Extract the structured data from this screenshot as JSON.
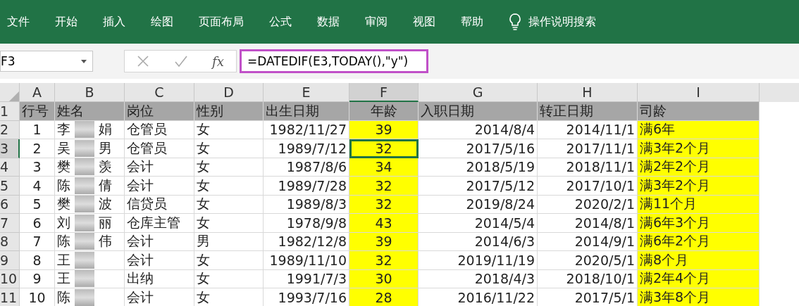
{
  "ribbon_tabs": [
    {
      "label": "文件"
    },
    {
      "label": "开始"
    },
    {
      "label": "插入"
    },
    {
      "label": "绘图"
    },
    {
      "label": "页面布局"
    },
    {
      "label": "公式"
    },
    {
      "label": "数据"
    },
    {
      "label": "审阅"
    },
    {
      "label": "视图"
    },
    {
      "label": "帮助"
    }
  ],
  "tell_me": {
    "label": "操作说明搜索"
  },
  "formula_bar": {
    "name_box": "F3",
    "fx": "fx",
    "formula": "=DATEDIF(E3,TODAY(),\"y\")"
  },
  "columns": [
    {
      "label": "A",
      "selected": false,
      "highlighted": false
    },
    {
      "label": "B",
      "selected": false,
      "highlighted": false
    },
    {
      "label": "C",
      "selected": false,
      "highlighted": false
    },
    {
      "label": "D",
      "selected": false,
      "highlighted": false
    },
    {
      "label": "E",
      "selected": false,
      "highlighted": false
    },
    {
      "label": "F",
      "selected": true,
      "highlighted": true
    },
    {
      "label": "G",
      "selected": false,
      "highlighted": false
    },
    {
      "label": "H",
      "selected": false,
      "highlighted": false
    },
    {
      "label": "I",
      "selected": false,
      "highlighted": true
    }
  ],
  "rows": [
    {
      "number": "1",
      "selected": false,
      "kind": "header",
      "cells": [
        "行号",
        "姓名",
        "岗位",
        "性别",
        "出生日期",
        "年龄",
        "入职日期",
        "转正日期",
        "司龄"
      ]
    },
    {
      "number": "2",
      "selected": false,
      "kind": "data",
      "cells": [
        "1",
        {
          "first": "李",
          "last": "娟"
        },
        "仓管员",
        "女",
        "1982/11/27",
        "39",
        "2014/8/4",
        "2014/11/1",
        "满6年"
      ]
    },
    {
      "number": "3",
      "selected": true,
      "kind": "data",
      "cells": [
        "2",
        {
          "first": "吴",
          "last": "男"
        },
        "仓管员",
        "女",
        "1989/7/12",
        "32",
        "2017/5/16",
        "2017/11/1",
        "满3年2个月"
      ]
    },
    {
      "number": "4",
      "selected": false,
      "kind": "data",
      "cells": [
        "3",
        {
          "first": "樊",
          "last": "羡"
        },
        "会计",
        "女",
        "1987/8/6",
        "34",
        "2018/5/19",
        "2018/11/1",
        "满2年2个月"
      ]
    },
    {
      "number": "5",
      "selected": false,
      "kind": "data",
      "cells": [
        "4",
        {
          "first": "陈",
          "last": "倩"
        },
        "会计",
        "女",
        "1989/7/28",
        "32",
        "2017/5/12",
        "2017/10/1",
        "满3年2个月"
      ]
    },
    {
      "number": "6",
      "selected": false,
      "kind": "data",
      "cells": [
        "5",
        {
          "first": "樊",
          "last": "波"
        },
        "信贷员",
        "女",
        "1989/8/3",
        "32",
        "2019/8/24",
        "2020/2/1",
        "满11个月"
      ]
    },
    {
      "number": "7",
      "selected": false,
      "kind": "data",
      "cells": [
        "6",
        {
          "first": "刘",
          "last": "丽"
        },
        "仓库主管",
        "女",
        "1978/9/8",
        "43",
        "2014/5/4",
        "2014/8/1",
        "满6年3个月"
      ]
    },
    {
      "number": "8",
      "selected": false,
      "kind": "data",
      "cells": [
        "7",
        {
          "first": "陈",
          "last": "伟"
        },
        "会计",
        "男",
        "1982/12/8",
        "39",
        "2014/6/3",
        "2014/9/1",
        "满6年2个月"
      ]
    },
    {
      "number": "9",
      "selected": false,
      "kind": "data",
      "cells": [
        "8",
        {
          "first": "王"
        },
        "会计",
        "女",
        "1989/11/10",
        "32",
        "2019/11/19",
        "2020/5/1",
        "满8个月"
      ]
    },
    {
      "number": "10",
      "selected": false,
      "kind": "data",
      "cells": [
        "9",
        {
          "first": "王"
        },
        "出纳",
        "女",
        "1991/7/3",
        "30",
        "2018/4/3",
        "2018/10/1",
        "满2年4个月"
      ]
    },
    {
      "number": "11",
      "selected": false,
      "kind": "data",
      "cells": [
        "10",
        {
          "first": "陈"
        },
        "会计",
        "女",
        "1993/7/16",
        "28",
        "2016/11/22",
        "2017/5/1",
        "满3年8个月"
      ]
    }
  ]
}
